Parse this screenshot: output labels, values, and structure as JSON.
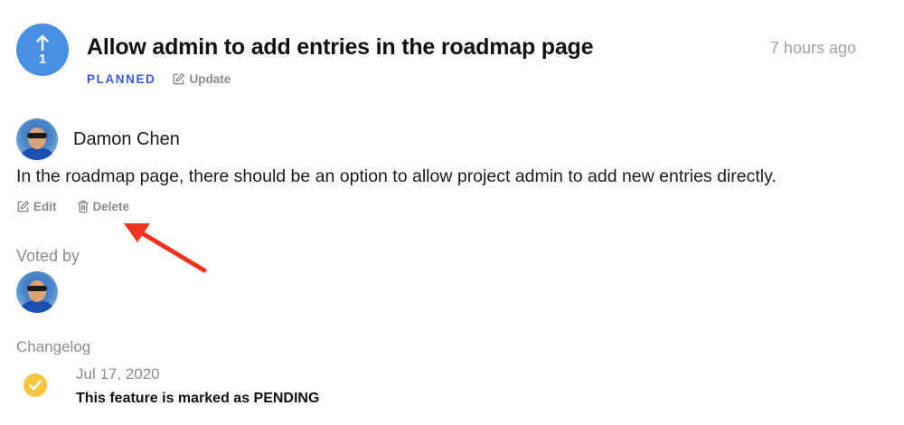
{
  "post": {
    "vote_count": "1",
    "title": "Allow admin to add entries in the roadmap page",
    "timestamp": "7 hours ago",
    "status": "PLANNED",
    "update_label": "Update",
    "status_color": "#3b5bdb",
    "vote_color": "#4a90e2"
  },
  "author": {
    "name": "Damon Chen"
  },
  "description": "In the roadmap page, there should be an option to allow project admin to add new entries directly.",
  "actions": {
    "edit_label": "Edit",
    "delete_label": "Delete"
  },
  "annotation": {
    "arrow_color": "#f0331e"
  },
  "voted_by": {
    "label": "Voted by"
  },
  "changelog": {
    "label": "Changelog",
    "entries": [
      {
        "date": "Jul 17, 2020",
        "text": "This feature is marked as PENDING",
        "icon": "check-circle-icon",
        "icon_color": "#f5c542"
      }
    ]
  }
}
